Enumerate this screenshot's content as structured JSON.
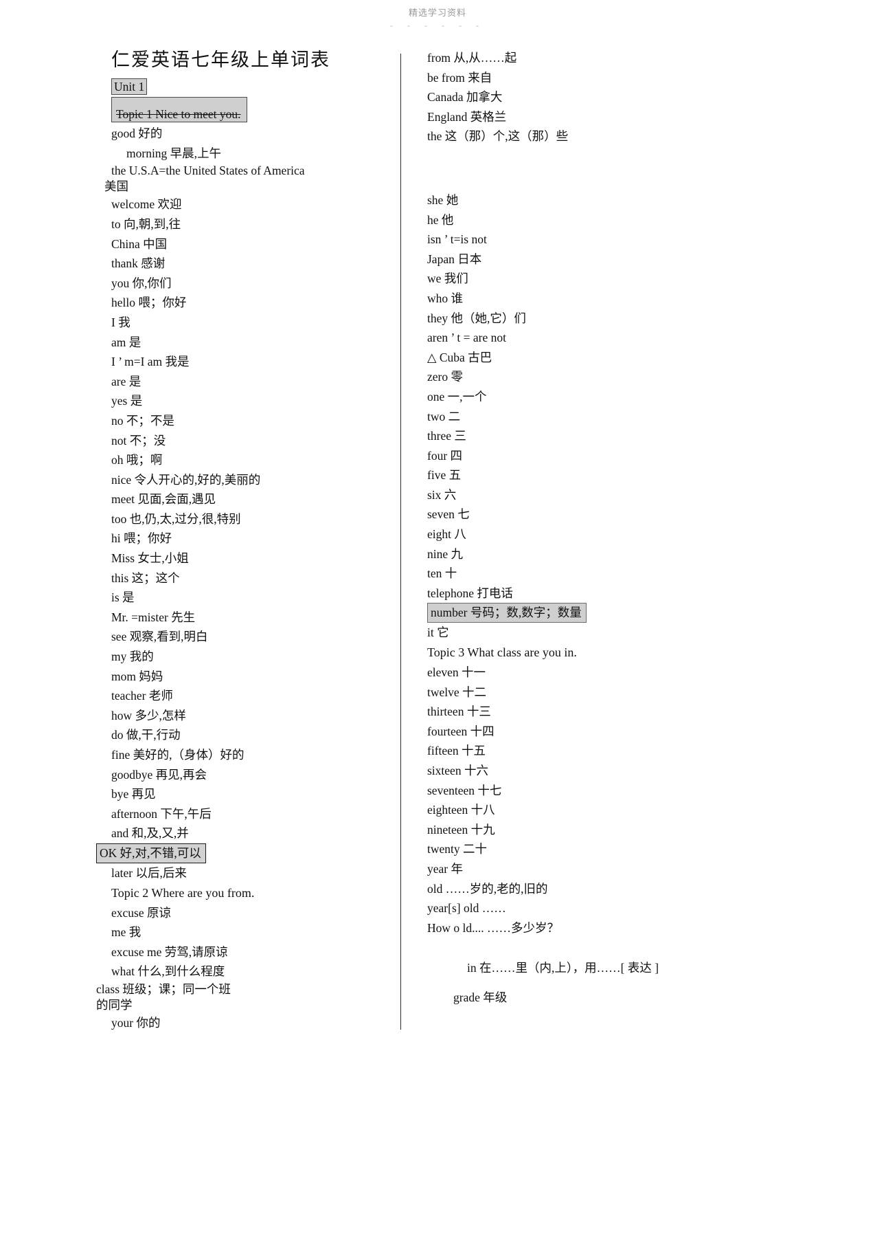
{
  "watermark": {
    "text": "精选学习资料",
    "dashes": "- - - - - -"
  },
  "document": {
    "title": "仁爱英语七年级上单词表"
  },
  "left_column": {
    "unit_label": "Unit 1",
    "topic1": "Topic 1    Nice to meet you.",
    "entries": [
      {
        "text": "good 好的",
        "indent": 2
      },
      {
        "text": "morning 早晨,上午",
        "indent": 4
      },
      {
        "text": "the U.S.A=the United States of America",
        "indent": 2
      },
      {
        "text": "美国",
        "indent": 1
      },
      {
        "text": "welcome 欢迎",
        "indent": 2
      },
      {
        "text": "to 向,朝,到,往",
        "indent": 2
      },
      {
        "text": "China 中国",
        "indent": 2
      },
      {
        "text": "thank 感谢",
        "indent": 2
      },
      {
        "text": "you 你,你们",
        "indent": 2
      },
      {
        "text": "hello 喂；你好",
        "indent": 2
      },
      {
        "text": "I 我",
        "indent": 2
      },
      {
        "text": "am 是",
        "indent": 2
      },
      {
        "text": "I ’  m=I am 我是",
        "indent": 2
      },
      {
        "text": "are 是",
        "indent": 2
      },
      {
        "text": "yes 是",
        "indent": 2
      },
      {
        "text": "no 不；不是",
        "indent": 2
      },
      {
        "text": "not 不；没",
        "indent": 2
      },
      {
        "text": "oh 哦；啊",
        "indent": 2
      },
      {
        "text": "nice 令人开心的,好的,美丽的",
        "indent": 2
      },
      {
        "text": "meet 见面,会面,遇见",
        "indent": 2
      },
      {
        "text": "too 也,仍,太,过分,很,特别",
        "indent": 2
      },
      {
        "text": "hi 喂；你好",
        "indent": 2
      },
      {
        "text": "Miss 女士,小姐",
        "indent": 2
      },
      {
        "text": "this 这；这个",
        "indent": 2
      },
      {
        "text": "is 是",
        "indent": 2
      },
      {
        "text": "Mr. =mister 先生",
        "indent": 2
      },
      {
        "text": "see 观察,看到,明白",
        "indent": 2
      },
      {
        "text": "my 我的",
        "indent": 2
      },
      {
        "text": "mom 妈妈",
        "indent": 2
      },
      {
        "text": "teacher 老师",
        "indent": 2
      },
      {
        "text": "how 多少,怎样",
        "indent": 2
      },
      {
        "text": "do 做,干,行动",
        "indent": 2
      },
      {
        "text": "fine 美好的,（身体）好的",
        "indent": 2
      },
      {
        "text": "goodbye 再见,再会",
        "indent": 2
      },
      {
        "text": "bye 再见",
        "indent": 2
      },
      {
        "text": "afternoon 下午,午后",
        "indent": 2
      },
      {
        "text": "and 和,及,又,并",
        "indent": 2
      }
    ],
    "ok_entry": "OK 好,对,不错,可以",
    "entries_after_ok": [
      {
        "text": "later 以后,后来",
        "indent": 2
      },
      {
        "text": "Topic 2     Where are you from.",
        "indent": 2
      },
      {
        "text": "excuse 原谅",
        "indent": 2
      },
      {
        "text": "me 我",
        "indent": 2
      },
      {
        "text": "excuse me 劳驾,请原谅",
        "indent": 2
      },
      {
        "text": "what 什么,到什么程度",
        "indent": 2
      },
      {
        "text": "class 班级；课；同一个班",
        "indent": 0
      },
      {
        "text": "的同学",
        "indent": 0
      },
      {
        "text": "your 你的",
        "indent": 2
      }
    ]
  },
  "right_column": {
    "entries_top": [
      {
        "text": "from 从,从……起",
        "indent": 2
      },
      {
        "text": "be from 来自",
        "indent": 2
      },
      {
        "text": "Canada 加拿大",
        "indent": 2
      },
      {
        "text": "England 英格兰",
        "indent": 2
      },
      {
        "text": "the 这（那）个,这（那）些",
        "indent": 2
      }
    ],
    "entries_mid": [
      {
        "text": "she 她",
        "indent": 2
      },
      {
        "text": "he 他",
        "indent": 2
      },
      {
        "text": "isn ’   t=is not",
        "indent": 2
      },
      {
        "text": "Japan 日本",
        "indent": 2
      },
      {
        "text": "we 我们",
        "indent": 2
      },
      {
        "text": "who 谁",
        "indent": 2
      },
      {
        "text": "they 他（她,它）们",
        "indent": 2
      },
      {
        "text": "aren ’   t = are not",
        "indent": 2
      },
      {
        "text": "△ Cuba 古巴",
        "indent": 2
      },
      {
        "text": "zero 零",
        "indent": 2
      },
      {
        "text": "one 一,一个",
        "indent": 2
      },
      {
        "text": "two 二",
        "indent": 2
      },
      {
        "text": "three 三",
        "indent": 2
      },
      {
        "text": "four 四",
        "indent": 2
      },
      {
        "text": "five 五",
        "indent": 2
      },
      {
        "text": "six 六",
        "indent": 2
      },
      {
        "text": "seven 七",
        "indent": 2
      },
      {
        "text": "eight 八",
        "indent": 2
      },
      {
        "text": "nine 九",
        "indent": 2
      },
      {
        "text": "ten 十",
        "indent": 2
      },
      {
        "text": "telephone 打电话",
        "indent": 2
      }
    ],
    "number_entry": "number 号码；数,数字；数量",
    "entries_after_number": [
      {
        "text": "it 它",
        "indent": 2
      },
      {
        "text": "Topic 3     What class are you in.",
        "indent": 3
      },
      {
        "text": "eleven 十一",
        "indent": 2
      },
      {
        "text": "twelve 十二",
        "indent": 2
      },
      {
        "text": "thirteen 十三",
        "indent": 2
      },
      {
        "text": "fourteen 十四",
        "indent": 2
      },
      {
        "text": "fifteen 十五",
        "indent": 2
      },
      {
        "text": "sixteen 十六",
        "indent": 2
      },
      {
        "text": "seventeen 十七",
        "indent": 2
      },
      {
        "text": "eighteen 十八",
        "indent": 2
      },
      {
        "text": "nineteen 十九",
        "indent": 2
      },
      {
        "text": "twenty 二十",
        "indent": 2
      },
      {
        "text": "year 年",
        "indent": 2
      },
      {
        "text": "old    ……岁的,老的,旧的",
        "indent": 2
      },
      {
        "text": "year[s] old       ……",
        "indent": 2
      },
      {
        "text": "How o ld....        ……多少岁？",
        "indent": 2
      }
    ],
    "entries_bottom": [
      {
        "text": "in 在……里（内,上），用……[ 表达 ]",
        "indent": 6
      },
      {
        "text": "grade 年级",
        "indent": 5
      }
    ]
  }
}
